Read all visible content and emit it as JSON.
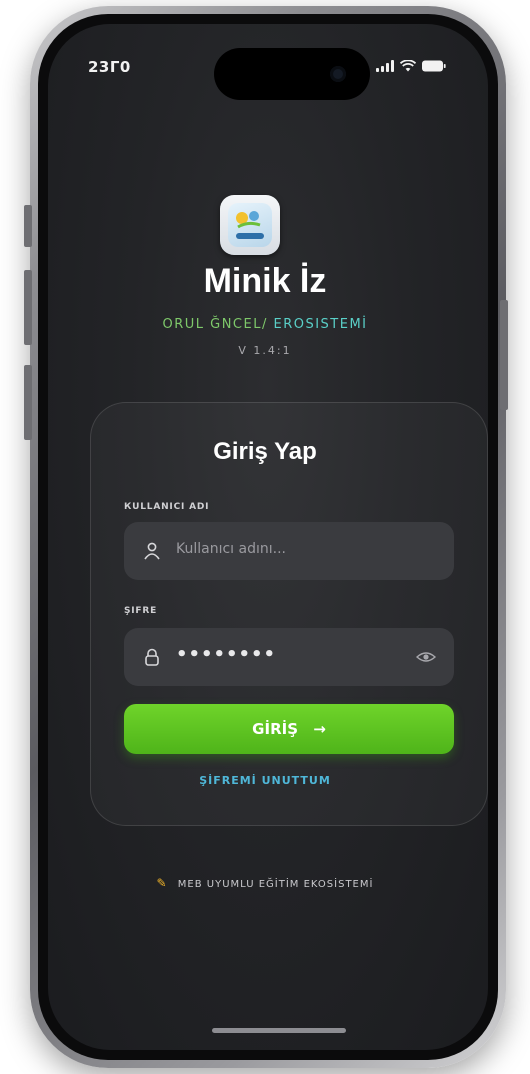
{
  "status_bar": {
    "time": "23Г0"
  },
  "app": {
    "title": "Minik İz",
    "subtitle_part1": "ОRUL ĞNCEL/",
    "subtitle_part2": "ЕRОSISTЕMİ",
    "version": "V 1.4:1"
  },
  "login": {
    "title": "Giriş Yap",
    "username_label": "КULLANICI ADI",
    "username_placeholder": "Kullanıcı adını...",
    "password_label": "ŞIFRE",
    "password_value": "••••••••",
    "button_label": "GİRİŞ",
    "button_arrow": "→",
    "forgot_label": "ŞİFREMİ UNUTTUM"
  },
  "footer": {
    "text": "MEB UYUMLU EĞİTİM EKOSİSTEMİ"
  },
  "colors": {
    "accent_green": "#5fc420",
    "link_blue": "#4fb7d8",
    "background": "#232427"
  }
}
